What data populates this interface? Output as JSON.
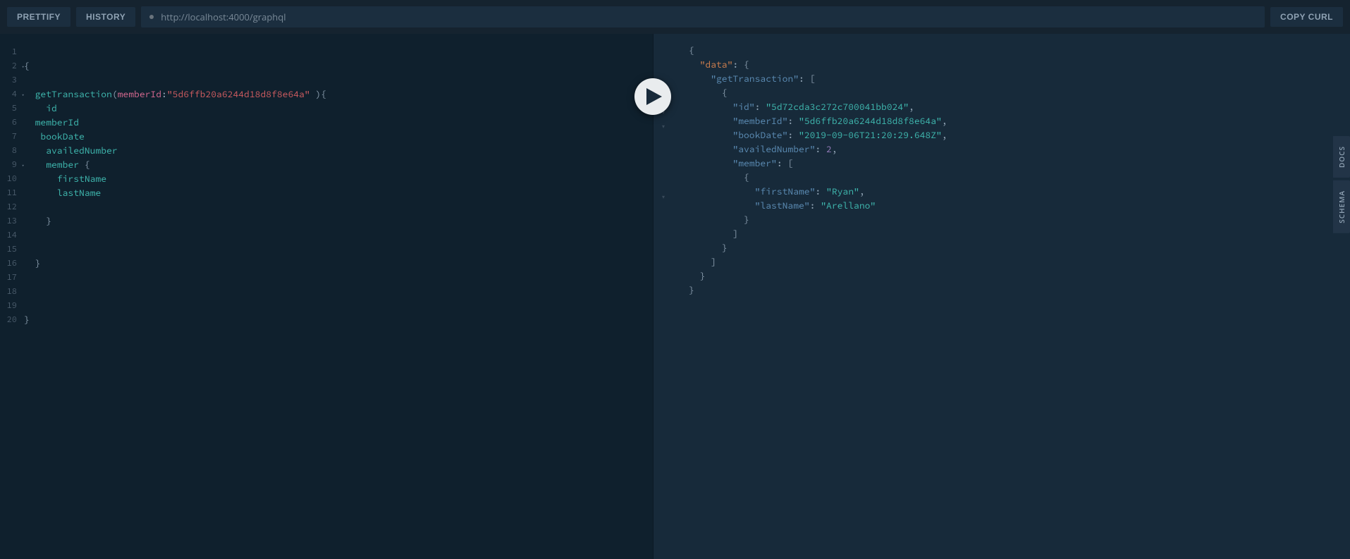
{
  "toolbar": {
    "prettify": "PRETTIFY",
    "history": "HISTORY",
    "copy_curl": "COPY CURL",
    "endpoint": "http://localhost:4000/graphql"
  },
  "side": {
    "docs": "DOCS",
    "schema": "SCHEMA"
  },
  "query": {
    "lines_total": 20,
    "fold_lines": [
      2,
      4,
      9
    ],
    "tokens": {
      "op": "getTransaction",
      "arg_name": "memberId",
      "arg_value": "\"5d6ffb20a6244d18d8f8e64a\"",
      "f_id": "id",
      "f_memberId": "memberId",
      "f_bookDate": "bookDate",
      "f_availedNumber": "availedNumber",
      "f_member": "member",
      "f_firstName": "firstName",
      "f_lastName": "lastName"
    }
  },
  "result": {
    "fold_lines": [
      1,
      2,
      3,
      4,
      9
    ],
    "keys": {
      "data": "\"data\"",
      "getTransaction": "\"getTransaction\"",
      "id": "\"id\"",
      "memberId": "\"memberId\"",
      "bookDate": "\"bookDate\"",
      "availedNumber": "\"availedNumber\"",
      "member": "\"member\"",
      "firstName": "\"firstName\"",
      "lastName": "\"lastName\""
    },
    "values": {
      "id": "\"5d72cda3c272c700041bb024\"",
      "memberId": "\"5d6ffb20a6244d18d8f8e64a\"",
      "bookDate": "\"2019-09-06T21:20:29.648Z\"",
      "availedNumber": "2",
      "firstName": "\"Ryan\"",
      "lastName": "\"Arellano\""
    }
  }
}
